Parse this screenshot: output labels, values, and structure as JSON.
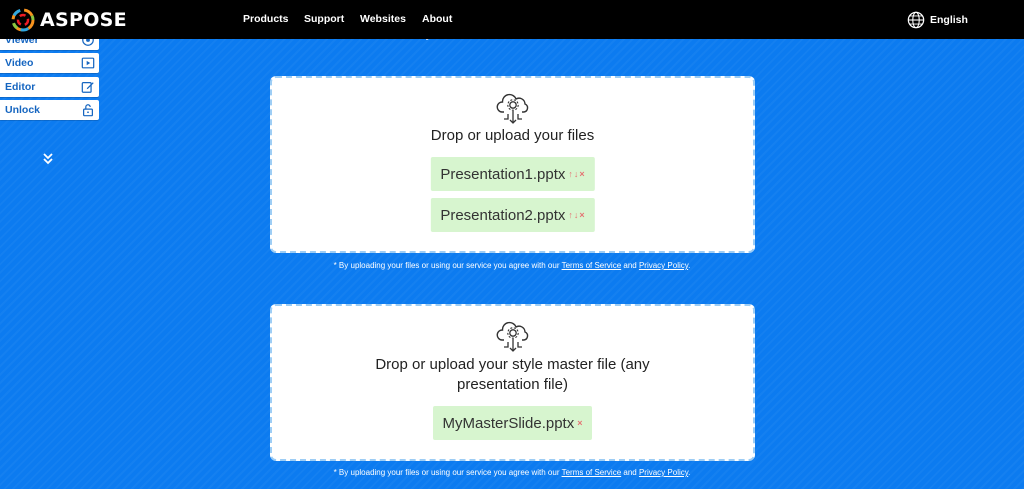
{
  "header": {
    "logo_text": "ASPOSE",
    "nav": [
      "Products",
      "Support",
      "Websites",
      "About"
    ],
    "language": "English"
  },
  "sidebar": {
    "items": [
      {
        "label": "Viewer",
        "icon": "eye-icon"
      },
      {
        "label": "Video",
        "icon": "video-icon"
      },
      {
        "label": "Editor",
        "icon": "edit-icon"
      },
      {
        "label": "Unlock",
        "icon": "unlock-icon"
      }
    ],
    "more_icon": "double-chevron-down-icon"
  },
  "upload1": {
    "title": "Drop or upload your files",
    "files": [
      {
        "name": "Presentation1.pptx",
        "actions": [
          "↑",
          "↓",
          "×"
        ]
      },
      {
        "name": "Presentation2.pptx",
        "actions": [
          "↑",
          "↓",
          "×"
        ]
      }
    ]
  },
  "upload2": {
    "title_line1": "Drop or upload your style master file (any",
    "title_line2": "presentation file)",
    "files": [
      {
        "name": "MyMasterSlide.pptx",
        "actions": [
          "×"
        ]
      }
    ]
  },
  "consent": {
    "prefix": "* By uploading your files or using our service you agree with our ",
    "terms": "Terms of Service",
    "and": " and ",
    "privacy": "Privacy Policy",
    "suffix": "."
  },
  "colors": {
    "background": "#0c7bf0",
    "topbar": "#000000",
    "chip": "#d7f5cf",
    "remove": "#e57373"
  }
}
